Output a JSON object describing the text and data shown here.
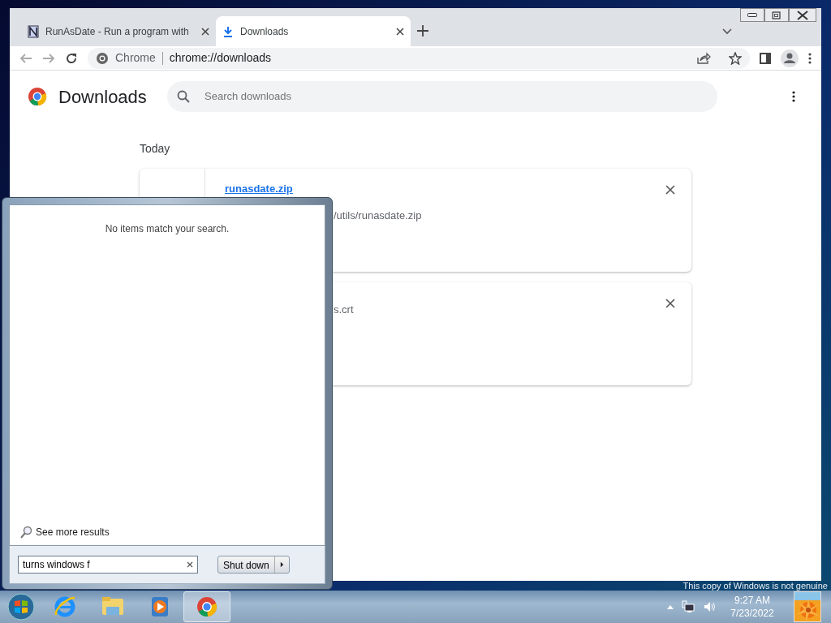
{
  "browser": {
    "tabs": [
      {
        "title": "RunAsDate - Run a program with",
        "selected": false
      },
      {
        "title": "Downloads",
        "selected": true
      }
    ],
    "omnibox": {
      "site": "Chrome",
      "url": "chrome://downloads"
    }
  },
  "downloads_page": {
    "title": "Downloads",
    "search": {
      "placeholder": "Search downloads"
    },
    "section": "Today",
    "items": [
      {
        "name": "runasdate.zip",
        "url": "/utils/runasdate.zip"
      },
      {
        "url": "s.crt"
      }
    ]
  },
  "start_menu": {
    "message": "No items match your search.",
    "see_more": "See more results",
    "search": {
      "value": "turns windows f"
    },
    "shutdown": "Shut down"
  },
  "desktop": {
    "notice": "This copy of Windows is not genuine"
  },
  "taskbar": {
    "apps": [
      {
        "kind": "ie",
        "selected": false
      },
      {
        "kind": "explorer",
        "selected": false
      },
      {
        "kind": "media",
        "selected": false
      },
      {
        "kind": "chrome",
        "selected": true
      }
    ],
    "clock": {
      "time": "9:27 AM",
      "date": "7/23/2022"
    }
  }
}
